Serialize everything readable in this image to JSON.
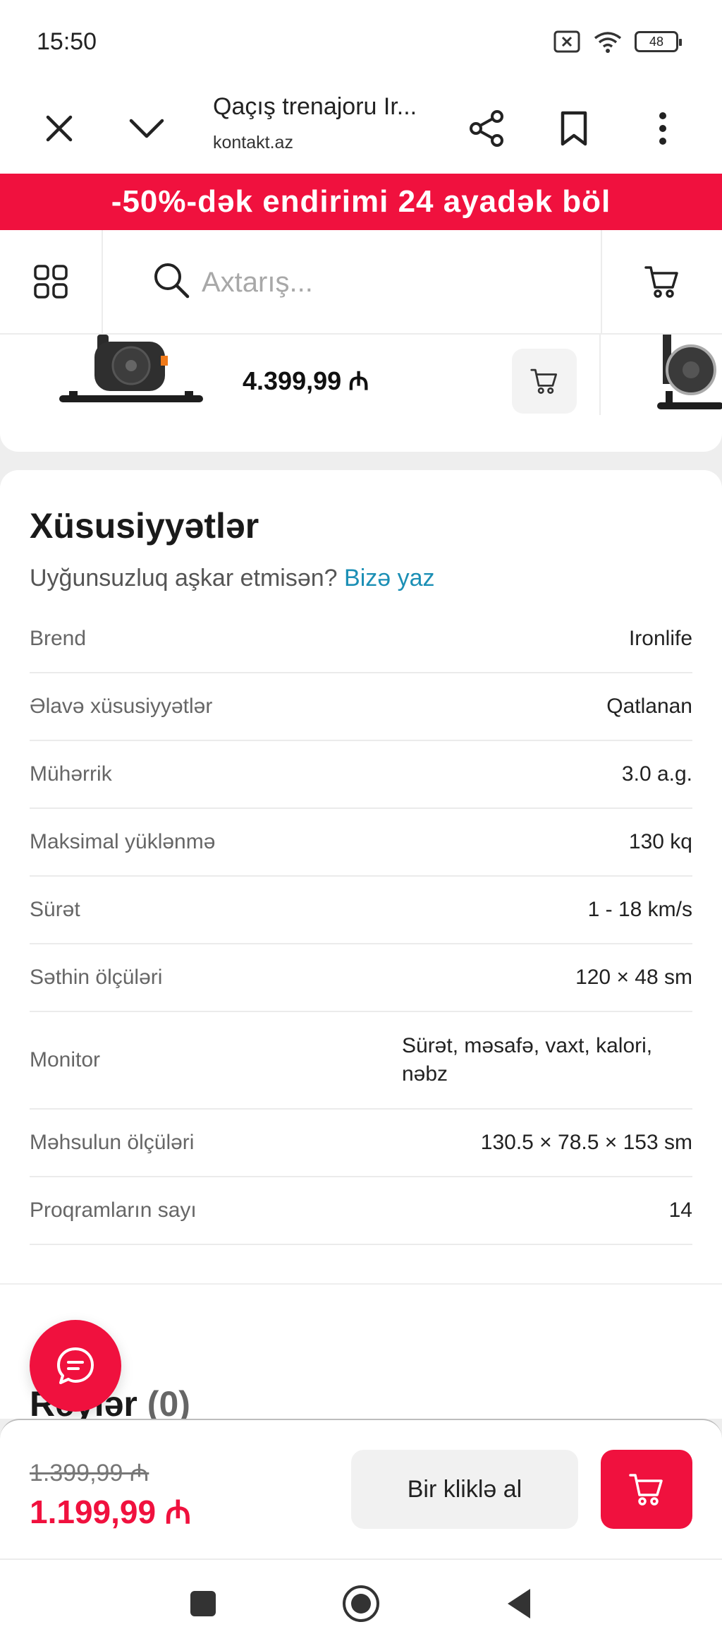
{
  "status": {
    "time": "15:50",
    "battery": "48"
  },
  "browser": {
    "title": "Qaçış trenajoru Ir...",
    "domain": "kontakt.az"
  },
  "promo": {
    "text": "-50%-dək endirimi 24 ayadək böl"
  },
  "search": {
    "placeholder": "Axtarış..."
  },
  "related": {
    "price": "4.399,99 ₼"
  },
  "specs": {
    "title": "Xüsusiyyətlər",
    "subtitle": "Uyğunsuzluq aşkar etmisən?",
    "link": "Bizə yaz",
    "rows": [
      {
        "key": "Brend",
        "value": "Ironlife"
      },
      {
        "key": "Əlavə xüsusiyyətlər",
        "value": "Qatlanan"
      },
      {
        "key": "Mühərrik",
        "value": "3.0 a.g."
      },
      {
        "key": "Maksimal yüklənmə",
        "value": "130 kq"
      },
      {
        "key": "Sürət",
        "value": "1 - 18 km/s"
      },
      {
        "key": "Səthin ölçüləri",
        "value": "120 × 48 sm"
      },
      {
        "key": "Monitor",
        "value": "Sürət, məsafə, vaxt, kalori, nəbz"
      },
      {
        "key": "Məhsulun ölçüləri",
        "value": "130.5 × 78.5 × 153 sm"
      },
      {
        "key": "Proqramların sayı",
        "value": "14"
      }
    ]
  },
  "reviews": {
    "title": "Rəylər",
    "count": "(0)"
  },
  "buy": {
    "old_price": "1.399,99 ₼",
    "new_price": "1.199,99 ₼",
    "oneclick_label": "Bir kliklə al"
  },
  "colors": {
    "accent": "#f0113e",
    "link": "#1b8fb5"
  },
  "icons": [
    "close-icon",
    "chevron-down-icon",
    "share-icon",
    "bookmark-icon",
    "more-icon",
    "grid-icon",
    "search-icon",
    "cart-icon",
    "chat-icon",
    "nav-recents-icon",
    "nav-home-icon",
    "nav-back-icon"
  ]
}
